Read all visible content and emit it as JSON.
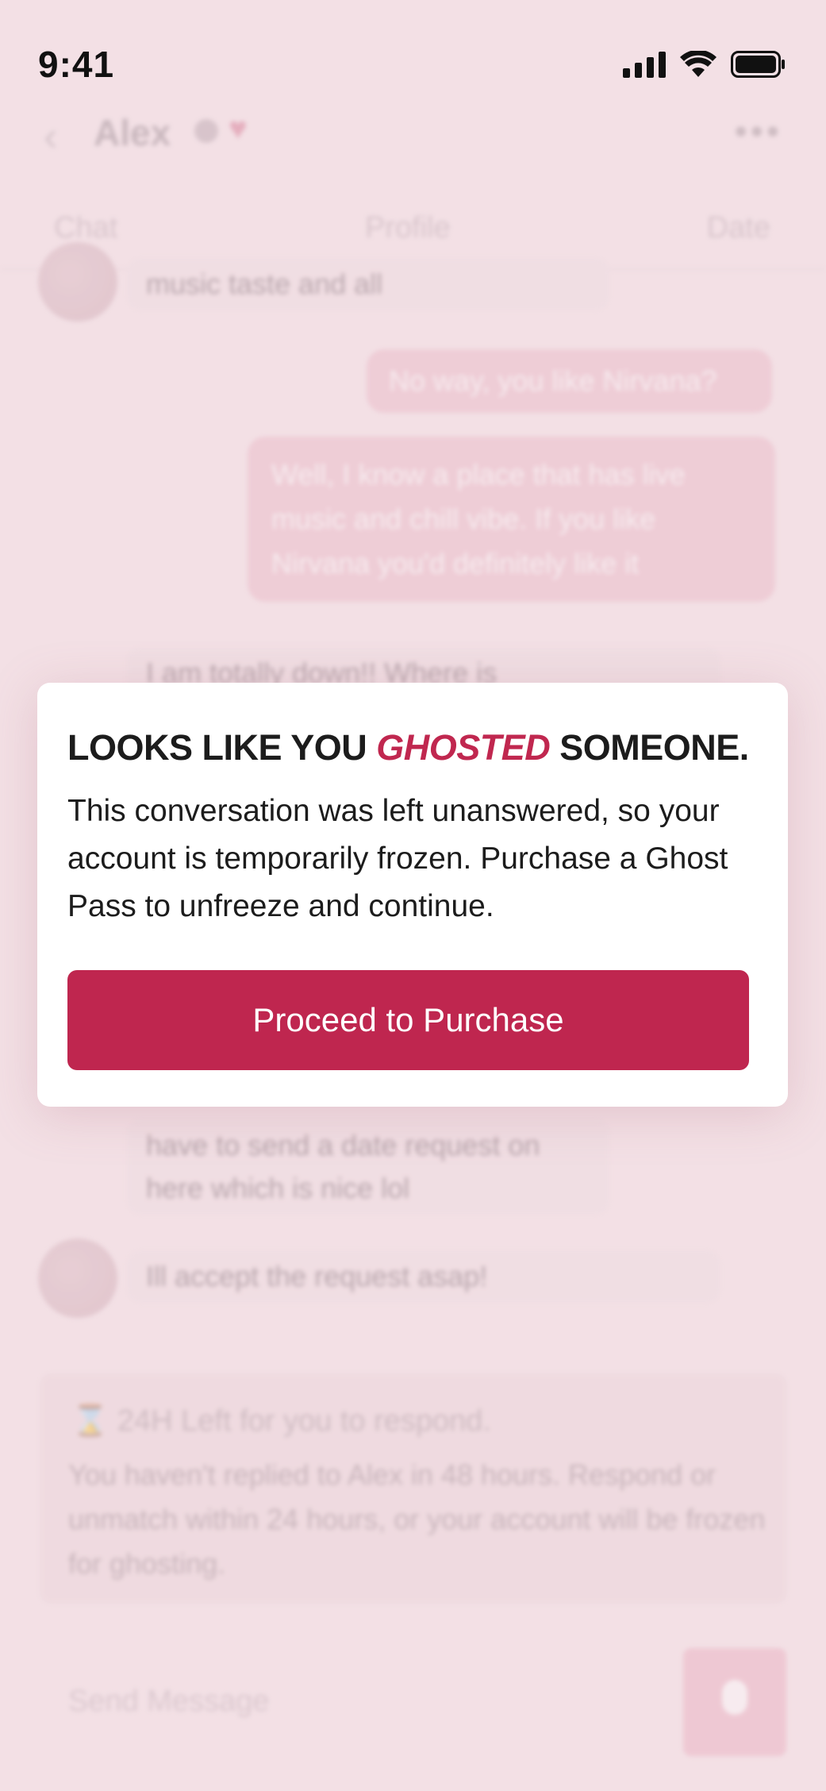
{
  "status_bar": {
    "time": "9:41",
    "signal_icon": "cellular-signal-icon",
    "wifi_icon": "wifi-icon",
    "battery_icon": "battery-icon"
  },
  "header": {
    "back_icon": "chevron-left-icon",
    "name": "Alex",
    "verified_icon": "verified-badge-icon",
    "heart_icon": "heart-icon",
    "more_icon": "more-dots-icon"
  },
  "tabs": [
    {
      "label": "Chat"
    },
    {
      "label": "Profile"
    },
    {
      "label": "Date"
    }
  ],
  "messages": {
    "m1": "music taste and all",
    "m2": "No way, you like Nirvana?",
    "m3": "Well, I know a place that has live music and chill vibe. If you like Nirvana you'd definitely like it",
    "m4": "I am totally down!! Where is",
    "m5": "have to send a date request on here which is nice lol",
    "m6": "Ill accept the request asap!"
  },
  "banner": {
    "icon": "hourglass-icon",
    "title": "24H Left for you to respond.",
    "body": "You haven't replied to Alex in 48 hours. Respond or unmatch within 24 hours, or your account will be frozen for ghosting."
  },
  "composer": {
    "placeholder": "Send Message",
    "mic_icon": "microphone-icon"
  },
  "modal": {
    "title_before": "LOOKS LIKE YOU ",
    "title_accent": "GHOSTED",
    "title_after": " SOMEONE.",
    "body": "This conversation was left unanswered, so your account is temporarily frozen. Purchase a Ghost Pass to unfreeze and continue.",
    "cta_label": "Proceed to Purchase"
  },
  "colors": {
    "accent": "#bf264f",
    "bubble_out": "#eab4c2",
    "background": "#f4e2e6"
  }
}
